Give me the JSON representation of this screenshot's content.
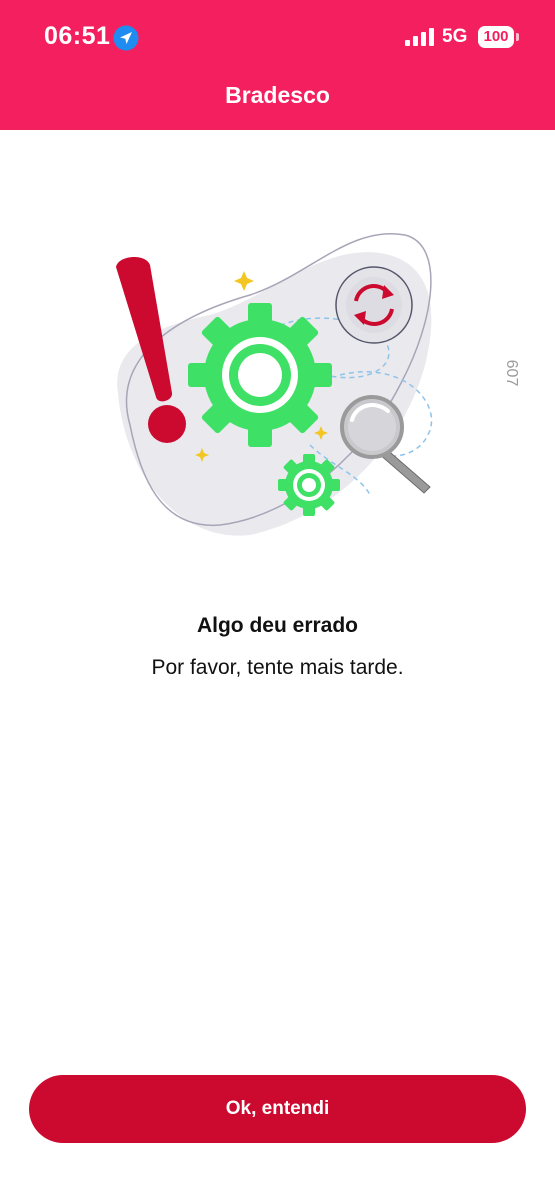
{
  "status_bar": {
    "time": "06:51",
    "network": "5G",
    "battery": "100",
    "location_icon": "location-arrow-icon",
    "signal_icon": "cellular-signal-icon"
  },
  "header": {
    "title": "Bradesco",
    "background_color": "#f41f5f"
  },
  "illustration": {
    "icons": [
      "exclamation-mark-icon",
      "gear-icon",
      "refresh-icon",
      "magnifier-icon",
      "sparkle-icon"
    ],
    "code_label": "607"
  },
  "error": {
    "title": "Algo deu errado",
    "message": "Por favor, tente mais tarde."
  },
  "actions": {
    "ok_label": "Ok, entendi",
    "button_color": "#cc0a2f"
  }
}
